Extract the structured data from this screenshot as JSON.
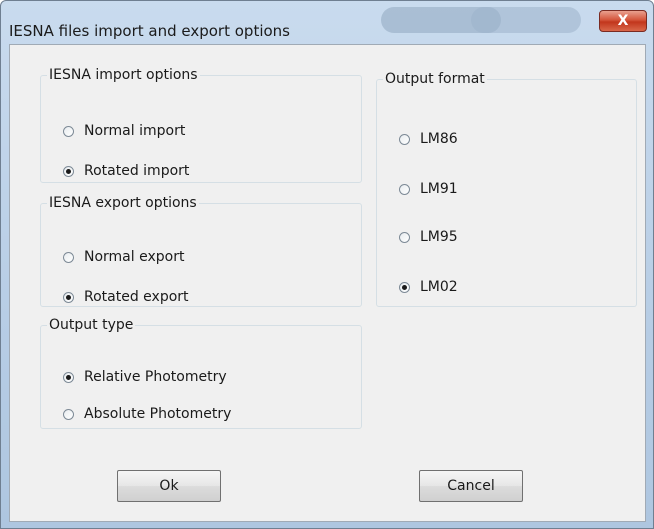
{
  "window": {
    "title": "IESNA files import and export options",
    "close_glyph": "X",
    "close_icon": "close-icon"
  },
  "import_options": {
    "legend": "IESNA import options",
    "options": [
      {
        "label": "Normal import",
        "checked": false
      },
      {
        "label": "Rotated import",
        "checked": true
      }
    ]
  },
  "export_options": {
    "legend": "IESNA export options",
    "options": [
      {
        "label": "Normal export",
        "checked": false
      },
      {
        "label": "Rotated export",
        "checked": true
      }
    ]
  },
  "output_type": {
    "legend": "Output type",
    "options": [
      {
        "label": "Relative Photometry",
        "checked": true
      },
      {
        "label": "Absolute Photometry",
        "checked": false
      }
    ]
  },
  "output_format": {
    "legend": "Output format",
    "options": [
      {
        "label": "LM86",
        "checked": false
      },
      {
        "label": "LM91",
        "checked": false
      },
      {
        "label": "LM95",
        "checked": false
      },
      {
        "label": "LM02",
        "checked": true
      }
    ]
  },
  "buttons": {
    "ok": "Ok",
    "cancel": "Cancel"
  }
}
